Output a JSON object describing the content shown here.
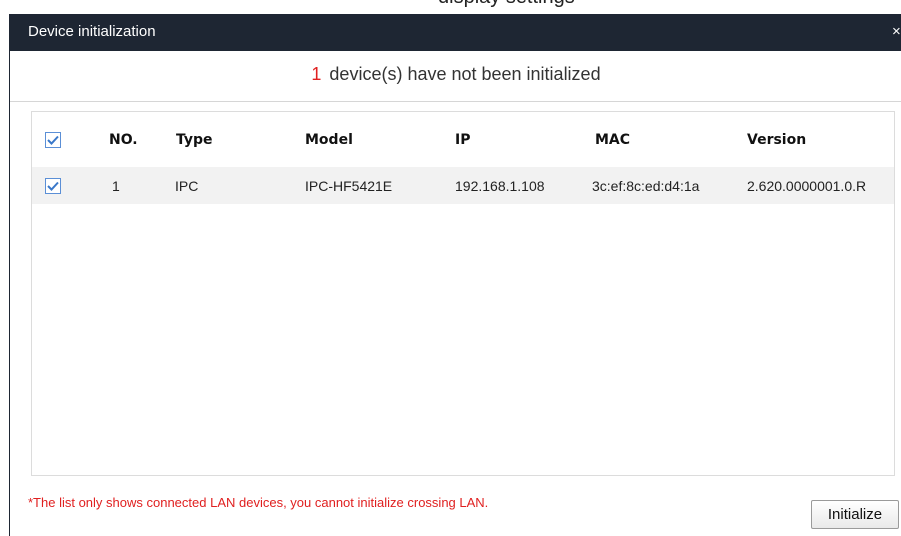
{
  "background_fragment": "display settings",
  "dialog": {
    "title": "Device initialization",
    "close_glyph": "×",
    "uninitialized_count": "1",
    "uninitialized_message": "device(s) have not been initialized",
    "table": {
      "header_all_checked": true,
      "columns": [
        "NO.",
        "Type",
        "Model",
        "IP",
        "MAC",
        "Version"
      ],
      "rows": [
        {
          "checked": true,
          "no": "1",
          "type": "IPC",
          "model": "IPC-HF5421E",
          "ip": "192.168.1.108",
          "mac": "3c:ef:8c:ed:d4:1a",
          "version": "2.620.0000001.0.R"
        }
      ]
    },
    "footer_note": "*The list only shows connected LAN devices, you cannot initialize crossing LAN.",
    "initialize_label": "Initialize"
  },
  "colors": {
    "titlebar": "#1e2633",
    "accent_red": "#e02020",
    "checkbox_blue": "#5b8fd6",
    "row_highlight": "#f2f2f2"
  },
  "icons": {
    "close": "close-icon",
    "checkbox": "checkmark-icon"
  }
}
